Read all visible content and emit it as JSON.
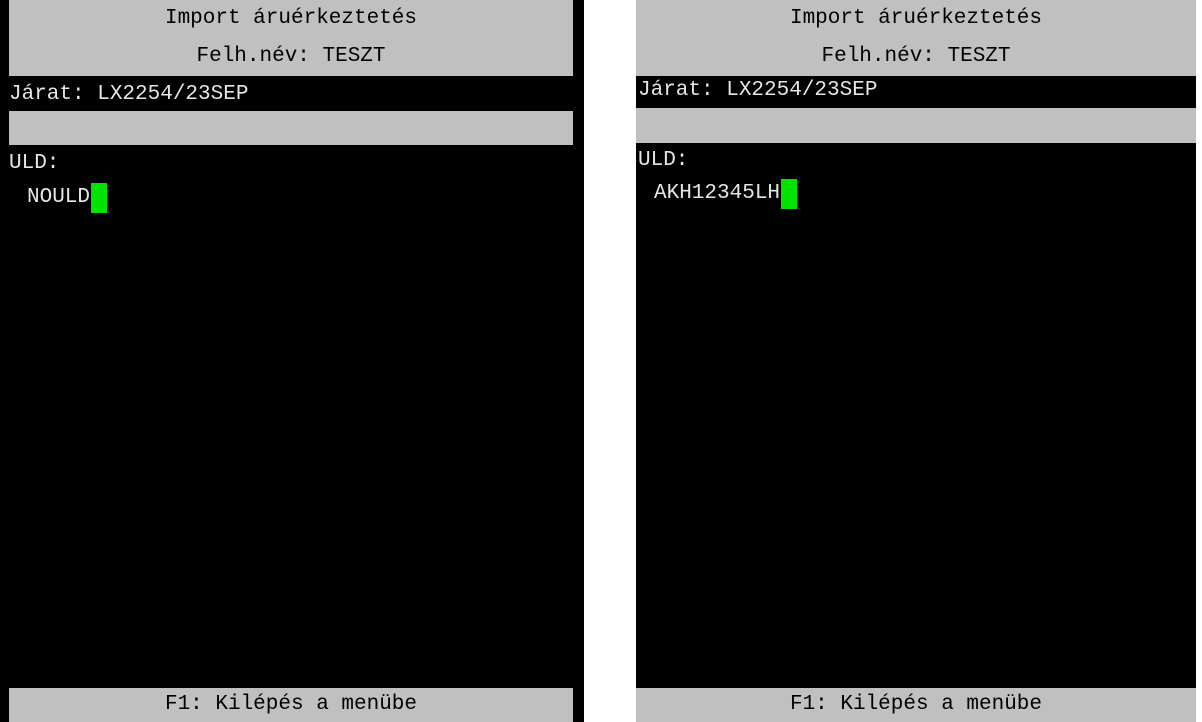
{
  "screens": [
    {
      "title": "Import áruérkeztetés",
      "user_line": "Felh.név: TESZT",
      "flight_line": "Járat: LX2254/23SEP",
      "uld_label": "ULD:",
      "uld_value": "NOULD",
      "footer": "F1: Kilépés a menübe"
    },
    {
      "title": "Import áruérkeztetés",
      "user_line": "Felh.név: TESZT",
      "flight_line": "Járat: LX2254/23SEP",
      "uld_label": "ULD:",
      "uld_value": "AKH12345LH",
      "footer": "F1: Kilépés a menübe"
    }
  ],
  "colors": {
    "screen_bg": "#000000",
    "bar_bg": "#c0c0c0",
    "text": "#e6e6e6",
    "cursor": "#00e400"
  }
}
